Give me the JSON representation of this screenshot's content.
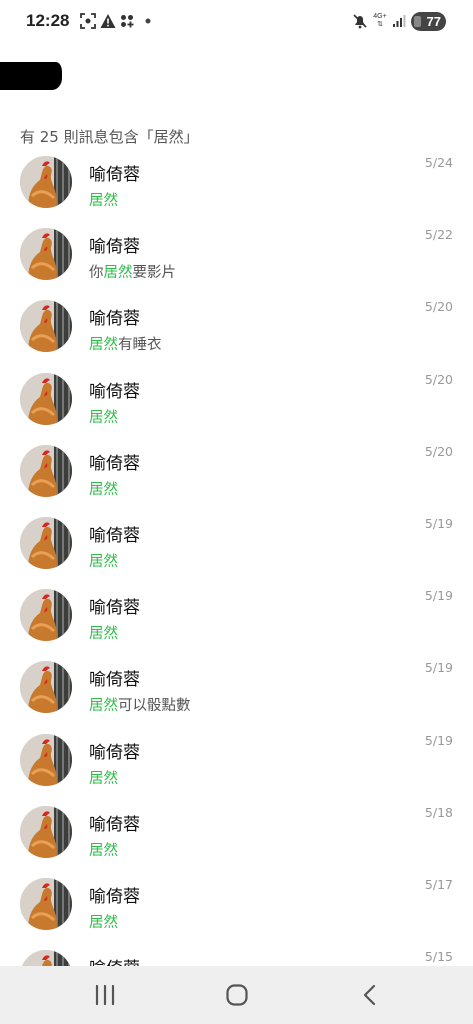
{
  "status_bar": {
    "time": "12:28",
    "network": "4G+",
    "battery": "77"
  },
  "search": {
    "results_count": "有 25 則訊息包含「居然」",
    "highlight_color": "#2dbd4a"
  },
  "messages": [
    {
      "name": "喻倚蓉",
      "pre": "",
      "hl": "居然",
      "post": "",
      "date": "5/24"
    },
    {
      "name": "喻倚蓉",
      "pre": "你",
      "hl": "居然",
      "post": "要影片",
      "date": "5/22"
    },
    {
      "name": "喻倚蓉",
      "pre": "",
      "hl": "居然",
      "post": "有睡衣",
      "date": "5/20"
    },
    {
      "name": "喻倚蓉",
      "pre": "",
      "hl": "居然",
      "post": "",
      "date": "5/20"
    },
    {
      "name": "喻倚蓉",
      "pre": "",
      "hl": "居然",
      "post": "",
      "date": "5/20"
    },
    {
      "name": "喻倚蓉",
      "pre": "",
      "hl": "居然",
      "post": "",
      "date": "5/19"
    },
    {
      "name": "喻倚蓉",
      "pre": "",
      "hl": "居然",
      "post": "",
      "date": "5/19"
    },
    {
      "name": "喻倚蓉",
      "pre": "",
      "hl": "居然",
      "post": "可以骰點數",
      "date": "5/19"
    },
    {
      "name": "喻倚蓉",
      "pre": "",
      "hl": "居然",
      "post": "",
      "date": "5/19"
    },
    {
      "name": "喻倚蓉",
      "pre": "",
      "hl": "居然",
      "post": "",
      "date": "5/18"
    },
    {
      "name": "喻倚蓉",
      "pre": "",
      "hl": "居然",
      "post": "",
      "date": "5/17"
    },
    {
      "name": "喻倚蓉",
      "pre": "",
      "hl": "",
      "post": "",
      "date": "5/15"
    }
  ],
  "icons": {
    "status_left": [
      "screenshot-icon",
      "warning-icon",
      "apps-icon"
    ],
    "status_right": [
      "mute-icon",
      "signal-icon",
      "battery-icon"
    ],
    "nav": [
      "recent-apps-icon",
      "home-icon",
      "back-icon"
    ]
  }
}
